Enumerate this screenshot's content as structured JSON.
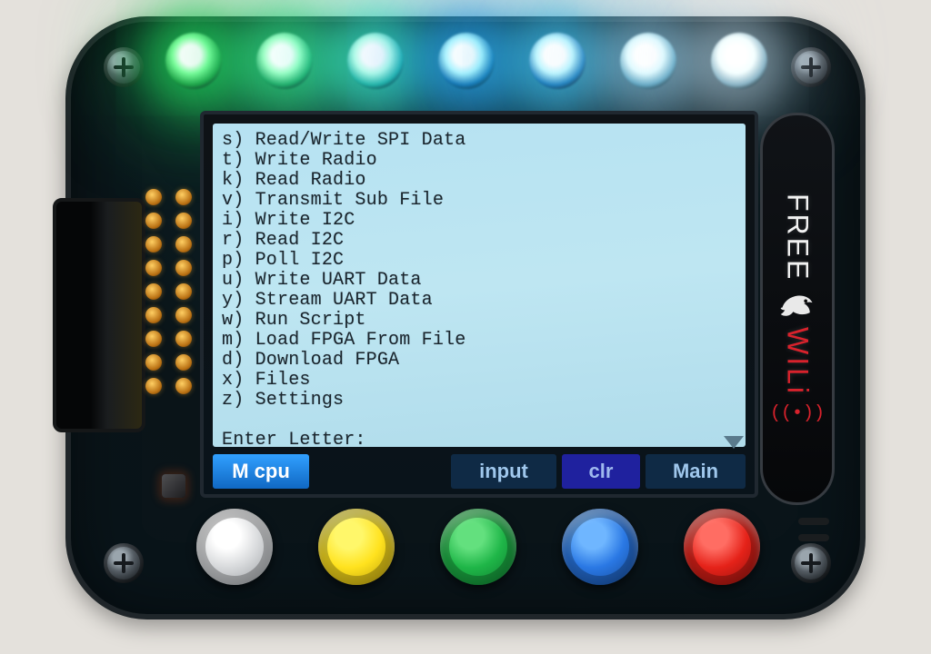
{
  "brand": {
    "line1": "FREE",
    "line2": "WILi",
    "antenna_glyph": "⚠"
  },
  "leds": [
    {
      "c1": "#7dff9c",
      "c2": "#1da045",
      "g": "rgba(32,210,90,.55)"
    },
    {
      "c1": "#a0ffc4",
      "c2": "#1fa864",
      "g": "rgba(50,220,130,.55)"
    },
    {
      "c1": "#b7ffe8",
      "c2": "#22b5a3",
      "g": "rgba(60,235,200,.55)"
    },
    {
      "c1": "#aef5ff",
      "c2": "#1576b5",
      "g": "rgba(40,160,235,.55)"
    },
    {
      "c1": "#bff7ff",
      "c2": "#1d7fbe",
      "g": "rgba(60,190,235,.55)"
    },
    {
      "c1": "#e1fbff",
      "c2": "#64a8c4",
      "g": "rgba(150,210,240,.40)"
    },
    {
      "c1": "#f4ffff",
      "c2": "#8ab4c6",
      "g": "rgba(200,230,245,.35)"
    }
  ],
  "menu": [
    {
      "key": "s",
      "label": "Read/Write SPI Data"
    },
    {
      "key": "t",
      "label": "Write Radio"
    },
    {
      "key": "k",
      "label": "Read Radio"
    },
    {
      "key": "v",
      "label": "Transmit Sub File"
    },
    {
      "key": "i",
      "label": "Write I2C"
    },
    {
      "key": "r",
      "label": "Read I2C"
    },
    {
      "key": "p",
      "label": "Poll I2C"
    },
    {
      "key": "u",
      "label": "Write UART Data"
    },
    {
      "key": "y",
      "label": "Stream UART Data"
    },
    {
      "key": "w",
      "label": "Run Script"
    },
    {
      "key": "m",
      "label": "Load FPGA From File"
    },
    {
      "key": "d",
      "label": "Download FPGA"
    },
    {
      "key": "x",
      "label": "Files"
    },
    {
      "key": "z",
      "label": "Settings"
    }
  ],
  "prompt": "Enter Letter:",
  "softkeys": {
    "left": "M cpu",
    "input": "input",
    "clr": "clr",
    "main": "Main"
  },
  "buttons": [
    {
      "h": "#ffffff",
      "m": "#d7d9db",
      "d": "#8b8f93",
      "name": "grey"
    },
    {
      "h": "#fff76a",
      "m": "#ffe21e",
      "d": "#a88d06",
      "name": "yellow"
    },
    {
      "h": "#63e07e",
      "m": "#1fb648",
      "d": "#0a6d28",
      "name": "green"
    },
    {
      "h": "#6fb6ff",
      "m": "#2a78e4",
      "d": "#103f86",
      "name": "blue"
    },
    {
      "h": "#ff6d63",
      "m": "#e52219",
      "d": "#7e0d0a",
      "name": "red"
    }
  ]
}
